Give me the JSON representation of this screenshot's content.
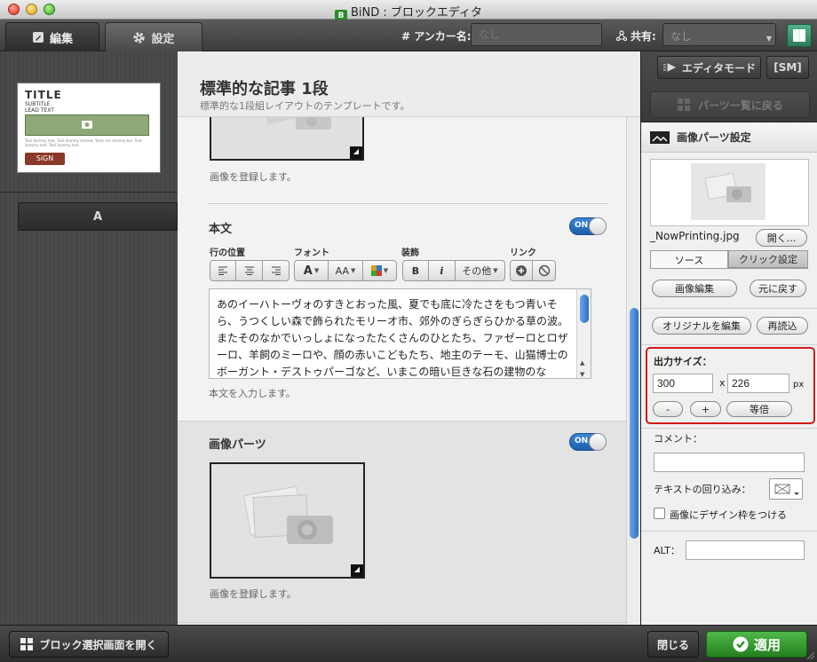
{
  "window": {
    "title": "BiND : ブロックエディタ",
    "app_icon": "B"
  },
  "toolbar": {
    "tab_edit": "編集",
    "tab_settings": "設定",
    "anchor_label": "# アンカー名:",
    "anchor_placeholder": "なし",
    "share_label": "共有:",
    "share_value": "なし"
  },
  "left": {
    "thumb_title": "TITLE",
    "thumb_subtitle": "SUBTITLE",
    "thumb_lead": "LEAD TEXT",
    "thumb_body": "Text dummy text. Text dummy textext. Texts are dummy tex. Text dummy text. Text dummy text.",
    "thumb_sign": "SiGN",
    "letter_tab": "A"
  },
  "center": {
    "title": "標準的な記事 1段",
    "subtitle": "標準的な1段組レイアウトのテンプレートです。",
    "image_hint_top": "画像を登録します。",
    "body_section_title": "本文",
    "toggle_on": "ON",
    "group_alignment": "行の位置",
    "group_font": "フォント",
    "group_decoration": "装飾",
    "group_link": "リンク",
    "btn_bold": "B",
    "btn_italic": "i",
    "btn_other": "その他",
    "btn_font": "A",
    "btn_font_size": "AA",
    "body_text": "あのイーハトーヴォのすきとおった風、夏でも底に冷たさをもつ青いそら、うつくしい森で飾られたモリーオ市、郊外のぎらぎらひかる草の波。またそのなかでいっしょになったたくさんのひとたち、ファゼーロとロザーロ、羊飼のミーロや、顔の赤いこどもたち、地主のテーモ、山猫博士のボーガント・デストゥパーゴなど、いまこの暗い巨きな石の建物のな",
    "body_hint": "本文を入力します。",
    "image_section_title": "画像パーツ",
    "image_hint_bottom": "画像を登録します。"
  },
  "right": {
    "editor_mode_btn": "エディタモード",
    "sm_btn": "[SM]",
    "parts_back_btn": "パーツ一覧に戻る",
    "section_title": "画像パーツ設定",
    "filename": "_NowPrinting.jpg",
    "open_btn": "開く...",
    "tab_source": "ソース",
    "tab_click": "クリック設定",
    "edit_image_btn": "画像編集",
    "revert_btn": "元に戻す",
    "edit_original_btn": "オリジナルを編集",
    "reload_btn": "再読込",
    "output_size_label": "出力サイズ：",
    "width_value": "300",
    "times": "x",
    "height_value": "226",
    "px_unit": "px",
    "minus_btn": "-",
    "plus_btn": "+",
    "equal_btn": "等倍",
    "comment_label": "コメント：",
    "text_wrap_label": "テキストの回り込み：",
    "design_frame_label": "画像にデザイン枠をつける",
    "alt_label": "ALT："
  },
  "footer": {
    "open_block_btn": "ブロック選択画面を開く",
    "close_btn": "閉じる",
    "apply_btn": "適用"
  },
  "colors": {
    "accent_blue": "#2e6fc4",
    "apply_green": "#3aa435",
    "highlight_red": "#d11a1a"
  }
}
